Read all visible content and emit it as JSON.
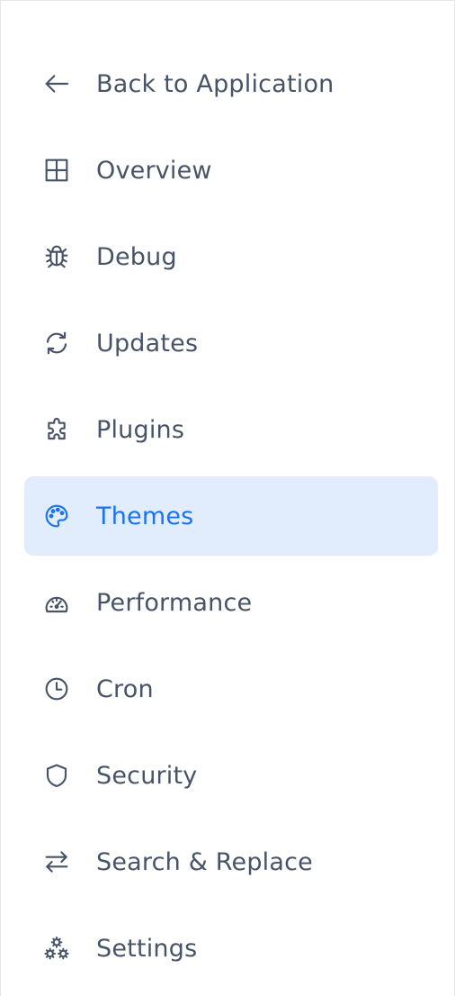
{
  "sidebar": {
    "items": [
      {
        "label": "Back to Application",
        "icon": "arrow-left-icon",
        "active": false
      },
      {
        "label": "Overview",
        "icon": "grid-icon",
        "active": false
      },
      {
        "label": "Debug",
        "icon": "bug-icon",
        "active": false
      },
      {
        "label": "Updates",
        "icon": "refresh-icon",
        "active": false
      },
      {
        "label": "Plugins",
        "icon": "puzzle-icon",
        "active": false
      },
      {
        "label": "Themes",
        "icon": "palette-icon",
        "active": true
      },
      {
        "label": "Performance",
        "icon": "gauge-icon",
        "active": false
      },
      {
        "label": "Cron",
        "icon": "clock-icon",
        "active": false
      },
      {
        "label": "Security",
        "icon": "shield-icon",
        "active": false
      },
      {
        "label": "Search & Replace",
        "icon": "arrows-swap-icon",
        "active": false
      },
      {
        "label": "Settings",
        "icon": "cogs-icon",
        "active": false
      }
    ]
  },
  "colors": {
    "text": "#475467",
    "active_text": "#1a73f0",
    "active_background": "#e1edfd",
    "border": "#e5e7eb"
  }
}
